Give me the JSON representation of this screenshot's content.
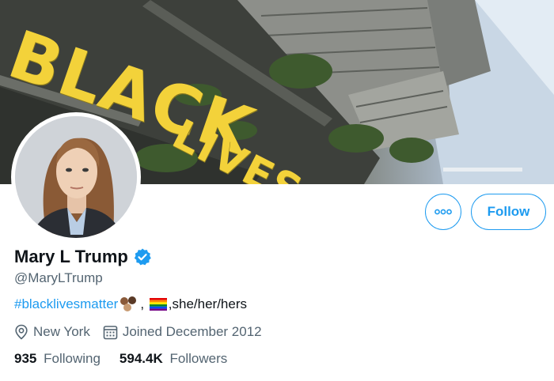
{
  "banner": {
    "painted_text_line1": "BLACK",
    "painted_text_line2": "LIVES MATTER"
  },
  "profile": {
    "display_name": "Mary L Trump",
    "handle": "@MaryLTrump",
    "verified": true,
    "bio": {
      "hashtag": "#blacklivesmatter",
      "after_emoji_1": ", ",
      "after_emoji_2": ",she/her/hers"
    },
    "location": "New York",
    "joined": "Joined December 2012"
  },
  "stats": {
    "following_count": "935",
    "following_label": "Following",
    "followers_count": "594.4K",
    "followers_label": "Followers"
  },
  "actions": {
    "follow_label": "Follow",
    "more_icon": "more-icon"
  },
  "colors": {
    "accent": "#1d9bf0",
    "text_primary": "#0f1419",
    "text_secondary": "#536471",
    "banner_paint": "#f3d23a"
  }
}
